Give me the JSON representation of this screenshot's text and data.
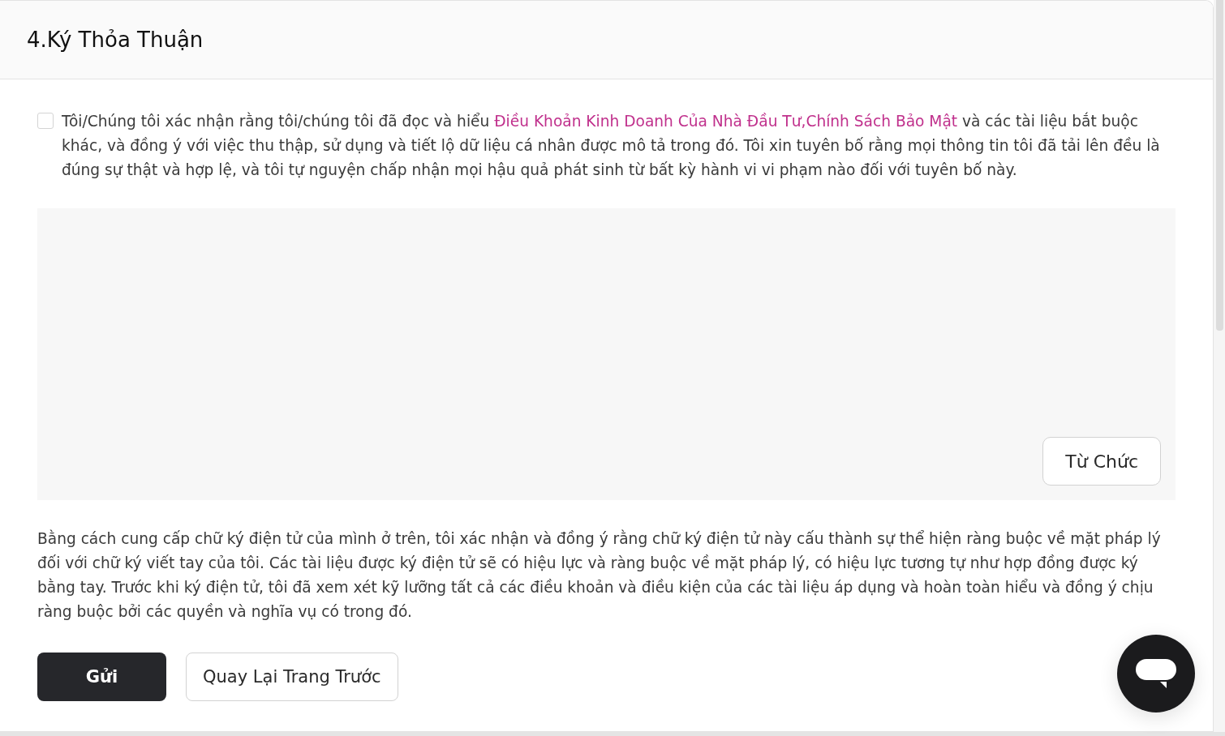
{
  "section": {
    "title": "4.Ký Thỏa Thuận"
  },
  "agreement": {
    "checked": false,
    "segments": [
      {
        "kind": "text",
        "text": "Tôi/Chúng tôi xác nhận rằng tôi/chúng tôi đã đọc và hiểu "
      },
      {
        "kind": "link",
        "text": "Điều Khoản Kinh Doanh Của Nhà Đầu Tư"
      },
      {
        "kind": "link",
        "text": ",Chính Sách Bảo Mật"
      },
      {
        "kind": "text",
        "text": " và các tài liệu bắt buộc khác, và đồng ý với việc thu thập, sử dụng và tiết lộ dữ liệu cá nhân được mô tả trong đó. Tôi xin tuyên bố rằng mọi thông tin tôi đã tải lên đều là đúng sự thật và hợp lệ, và tôi tự nguyện chấp nhận mọi hậu quả phát sinh từ bất kỳ hành vi vi phạm nào đối với tuyên bố này."
      }
    ]
  },
  "signature_pad": {
    "button": "Từ Chức"
  },
  "disclaimer": "Bằng cách cung cấp chữ ký điện tử của mình ở trên, tôi xác nhận và đồng ý rằng chữ ký điện tử này cấu thành sự thể hiện ràng buộc về mặt pháp lý đối với chữ ký viết tay của tôi. Các tài liệu được ký điện tử sẽ có hiệu lực và ràng buộc về mặt pháp lý, có hiệu lực tương tự như hợp đồng được ký bằng tay. Trước khi ký điện tử, tôi đã xem xét kỹ lưỡng tất cả các điều khoản và điều kiện của các tài liệu áp dụng và hoàn toàn hiểu và đồng ý chịu ràng buộc bởi các quyền và nghĩa vụ có trong đó.",
  "buttons": [
    {
      "kind": "primary",
      "label": "Gửi"
    },
    {
      "kind": "secondary",
      "label": "Quay Lại Trang Trước"
    }
  ]
}
